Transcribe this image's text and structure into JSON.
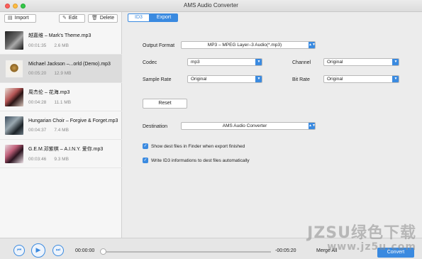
{
  "window": {
    "title": "AMS Audio Converter"
  },
  "sidebar": {
    "toolbar": {
      "import_label": "Import",
      "edit_label": "Edit",
      "delete_label": "Delete"
    },
    "files": [
      {
        "name": "越嘉维 – Mark's Theme.mp3",
        "duration": "00:01:35",
        "size": "2.6 MB",
        "selected": false
      },
      {
        "name": "Michael Jackson –...orld (Demo).mp3",
        "duration": "00:05:20",
        "size": "12.9 MB",
        "selected": true
      },
      {
        "name": "周杰伦 – 花海.mp3",
        "duration": "00:04:28",
        "size": "11.1 MB",
        "selected": false
      },
      {
        "name": "Hungarian Choir – Forgive & Forget.mp3",
        "duration": "00:04:37",
        "size": "7.4 MB",
        "selected": false
      },
      {
        "name": "G.E.M.邓紫棋 – A.I.N.Y. 爱你.mp3",
        "duration": "00:03:46",
        "size": "9.3 MB",
        "selected": false
      }
    ]
  },
  "tabs": {
    "id3": "ID3",
    "export": "Export"
  },
  "export": {
    "output_format_label": "Output Format",
    "output_format_value": "MP3 – MPEG Layer–3 Audio(*.mp3)",
    "codec_label": "Codec",
    "codec_value": "mp3",
    "channel_label": "Channel",
    "channel_value": "Original",
    "sample_rate_label": "Sample Rate",
    "sample_rate_value": "Original",
    "bit_rate_label": "Bit Rate",
    "bit_rate_value": "Original",
    "reset_label": "Reset",
    "destination_label": "Destination",
    "destination_value": "AMS Audio Converter",
    "show_in_finder_label": "Show dest files in Finder when export finished",
    "show_in_finder_checked": true,
    "write_id3_label": "Write ID3 informations to dest files automatically",
    "write_id3_checked": true
  },
  "player": {
    "current_time": "00:00:00",
    "remaining_time": "-00:05:20",
    "merge_label": "Merge All",
    "convert_label": "Convert"
  },
  "watermark": {
    "brand": "JZSU绿色下载",
    "url": "www.jz5u.com"
  },
  "colors": {
    "accent": "#3a8ae0"
  }
}
